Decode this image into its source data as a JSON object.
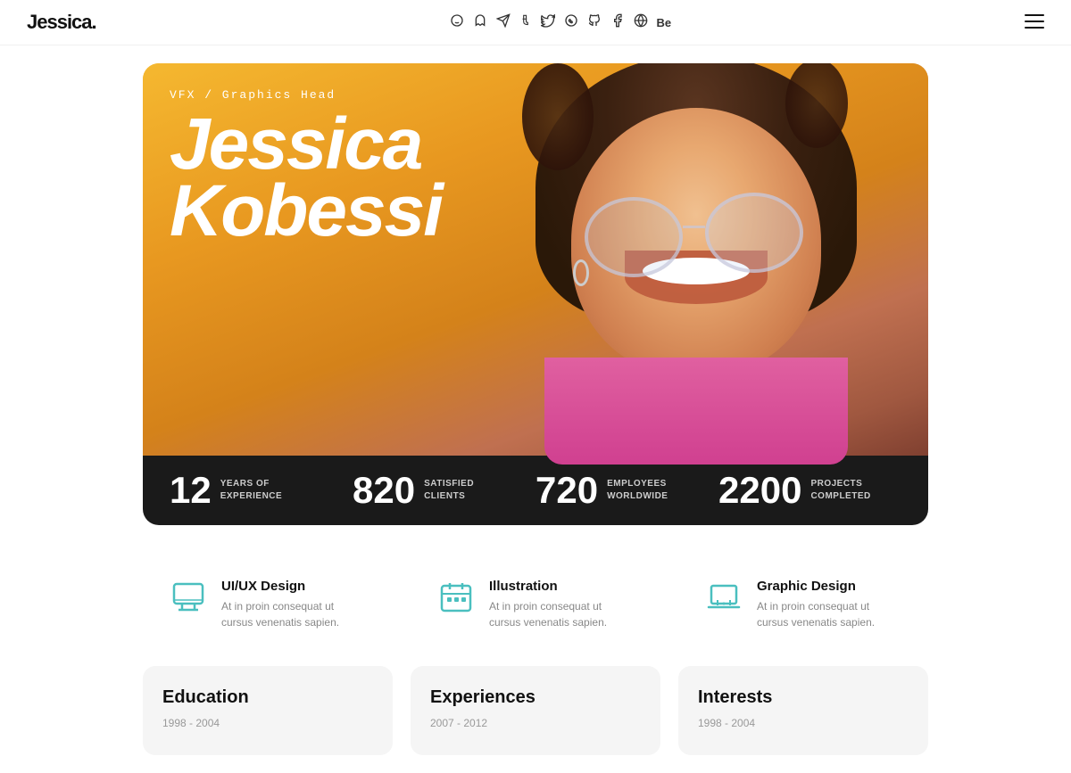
{
  "header": {
    "logo": "Jessica.",
    "menu_icon": "≡",
    "social_icons": [
      "👁",
      "👻",
      "✈",
      "🔶",
      "🐦",
      "💬",
      "🐙",
      "📘",
      "⭕",
      "🅱"
    ]
  },
  "hero": {
    "subtitle": "VFX / Graphics Head",
    "first_name": "Jessica",
    "last_name": "Kobessi"
  },
  "stats": [
    {
      "number": "12",
      "label_line1": "YEARS OF",
      "label_line2": "EXPERIENCE"
    },
    {
      "number": "820",
      "label_line1": "SATISFIED",
      "label_line2": "CLIENTS"
    },
    {
      "number": "720",
      "label_line1": "EMPLOYEES",
      "label_line2": "WORLDWIDE"
    },
    {
      "number": "2200",
      "label_line1": "PROJECTS",
      "label_line2": "COMPLETED"
    }
  ],
  "skills": [
    {
      "name": "UI/UX Design",
      "description": "At in proin consequat ut cursus venenatis sapien.",
      "icon": "monitor"
    },
    {
      "name": "Illustration",
      "description": "At in proin consequat ut cursus venenatis sapien.",
      "icon": "calendar"
    },
    {
      "name": "Graphic Design",
      "description": "At in proin consequat ut cursus venenatis sapien.",
      "icon": "laptop"
    }
  ],
  "cards": [
    {
      "title": "Education",
      "year": "1998 - 2004"
    },
    {
      "title": "Experiences",
      "year": "2007 - 2012"
    },
    {
      "title": "Interests",
      "year": "1998 - 2004"
    }
  ]
}
